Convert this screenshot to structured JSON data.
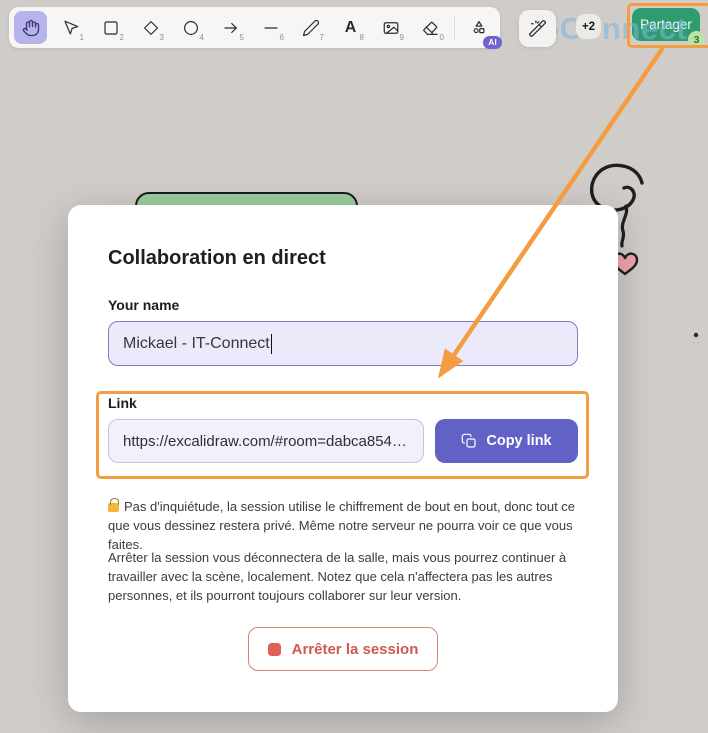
{
  "toolbar": {
    "tools": [
      {
        "name": "hand",
        "shortcut": "",
        "selected": true
      },
      {
        "name": "selection",
        "shortcut": "1"
      },
      {
        "name": "rectangle",
        "shortcut": "2"
      },
      {
        "name": "diamond",
        "shortcut": "3"
      },
      {
        "name": "ellipse",
        "shortcut": "4"
      },
      {
        "name": "arrow",
        "shortcut": "5"
      },
      {
        "name": "line",
        "shortcut": "6"
      },
      {
        "name": "draw",
        "shortcut": "7"
      },
      {
        "name": "text",
        "shortcut": "8",
        "glyph": "A"
      },
      {
        "name": "image",
        "shortcut": "9"
      },
      {
        "name": "eraser",
        "shortcut": "0"
      },
      {
        "name": "shapes-ai",
        "badge": "AI"
      }
    ],
    "ai_badge": "AI"
  },
  "topbar": {
    "collaborators_more": "+2",
    "share_label": "Partager",
    "share_count": "3"
  },
  "watermark": {
    "text": "IT-Connect"
  },
  "dialog": {
    "title": "Collaboration en direct",
    "name_label": "Your name",
    "name_value": "Mickael - IT-Connect",
    "link_label": "Link",
    "link_value": "https://excalidraw.com/#room=dabca854…",
    "copy_button": "Copy link",
    "privacy_note": "Pas d'inquiétude, la session utilise le chiffrement de bout en bout, donc tout ce que vous dessinez restera privé. Même notre serveur ne pourra voir ce que vous faites.",
    "stop_note": "Arrêter la session vous déconnectera de la salle, mais vous pourrez continuer à travailler avec la scène, localement. Notez que cela n'affectera pas les autres personnes, et ils pourront toujours collaborer sur leur version.",
    "stop_button": "Arrêter la session"
  },
  "icons": {
    "toolbar": [
      "hand-icon",
      "mouse-pointer-icon",
      "rectangle-icon",
      "diamond-icon",
      "ellipse-icon",
      "arrow-icon",
      "line-icon",
      "pencil-icon",
      "text-icon",
      "image-icon",
      "eraser-icon",
      "shapes-icon"
    ],
    "other": [
      "magic-wand-icon",
      "copy-icon",
      "stop-icon",
      "lock-icon"
    ]
  },
  "colors": {
    "accent_orange": "#f59c42",
    "primary_purple": "#6261c6",
    "share_green": "#2e9c6d",
    "danger_red": "#cf5a52",
    "selected_tool_bg": "#b7b4ec",
    "canvas_bg": "#d0cdc9",
    "watermark_blue": "#7db4dc",
    "doodle_heart_pink": "#f0a8ae"
  }
}
